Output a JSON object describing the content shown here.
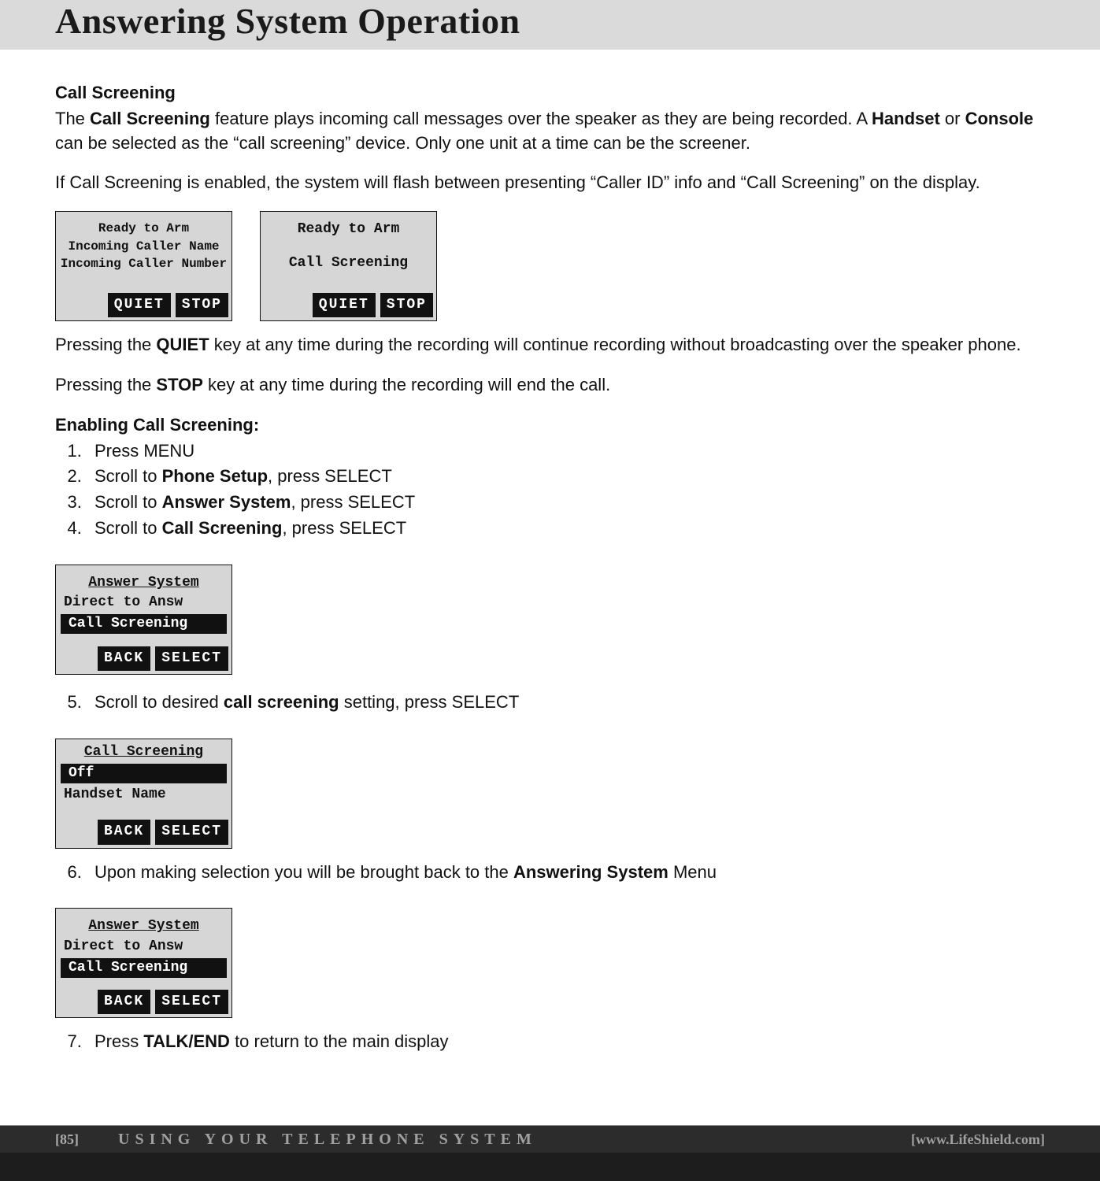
{
  "header": {
    "title": "Answering System Operation"
  },
  "section": {
    "heading": "Call Screening",
    "intro_before": "The ",
    "intro_bold": "Call Screening",
    "intro_mid": " feature plays incoming call messages over the speaker as they are being recorded. A ",
    "handset": "Handset",
    "intro_or": " or ",
    "console": "Console",
    "intro_after": " can be selected as the “call screening” device. Only one unit at a time can be the screener.",
    "flash_line": "If Call Screening is enabled, the system will flash between presenting “Caller ID” info and “Call Screening” on the display."
  },
  "lcd1": {
    "line1": "Ready to Arm",
    "line2": "Incoming Caller Name",
    "line3": "Incoming Caller Number",
    "soft_left": "QUIET",
    "soft_right": "STOP"
  },
  "lcd2": {
    "line1": "Ready to Arm",
    "line2": "Call Screening",
    "soft_left": "QUIET",
    "soft_right": "STOP"
  },
  "press_quiet_pre": "Pressing the ",
  "press_quiet_key": "QUIET",
  "press_quiet_post": " key at any time during the recording will continue recording without broadcasting over the speaker phone.",
  "press_stop_pre": "Pressing the ",
  "press_stop_key": "STOP",
  "press_stop_post": " key at any time during the recording will end the call.",
  "enabling_heading": "Enabling Call Screening:",
  "steps": {
    "s1": "Press MENU",
    "s2_pre": "Scroll to ",
    "s2_bold": "Phone Setup",
    "s2_post": ", press SELECT",
    "s3_pre": "Scroll to ",
    "s3_bold": "Answer System",
    "s3_post": ", press SELECT",
    "s4_pre": "Scroll to ",
    "s4_bold": "Call Screening",
    "s4_post": ", press SELECT",
    "s5_pre": "Scroll to desired ",
    "s5_bold": "call screening",
    "s5_post": " setting, press SELECT",
    "s6_pre": "Upon making selection you will be brought back to the ",
    "s6_bold": "Answering System",
    "s6_post": " Menu",
    "s7_pre": "Press ",
    "s7_bold": "TALK/END",
    "s7_post": " to return to the main display"
  },
  "lcd3": {
    "title": "Answer System",
    "item1": "Direct to Answ",
    "highlight": "Call Screening",
    "soft_left": "BACK",
    "soft_right": "SELECT"
  },
  "lcd4": {
    "title": "Call Screening",
    "highlight": "Off",
    "item1": "Handset Name",
    "soft_left": "BACK",
    "soft_right": "SELECT"
  },
  "lcd5": {
    "title": "Answer System",
    "item1": "Direct to Answ",
    "highlight": "Call Screening",
    "soft_left": "BACK",
    "soft_right": "SELECT"
  },
  "footer": {
    "page_num": "[85]",
    "center": "USING YOUR TELEPHONE SYSTEM",
    "right": "[www.LifeShield.com]"
  }
}
